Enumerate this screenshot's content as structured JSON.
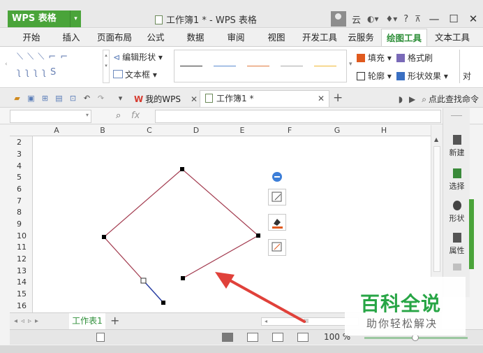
{
  "app": {
    "name": "WPS 表格",
    "title": "工作簿1 * - WPS 表格"
  },
  "titlebar": {
    "cloud_label": "云",
    "help_label": "?",
    "minimize": "—",
    "maximize": "☐",
    "close": "✕"
  },
  "menu_tabs": [
    "开始",
    "插入",
    "页面布局",
    "公式",
    "数据",
    "审阅",
    "视图",
    "开发工具",
    "云服务",
    "绘图工具",
    "文本工具"
  ],
  "active_tab": "绘图工具",
  "ribbon": {
    "edit_shape": "编辑形状",
    "textbox": "文本框",
    "fill": "填充",
    "format_painter": "格式刷",
    "outline": "轮廓",
    "shape_effects": "形状效果",
    "align_fragment": "对"
  },
  "quickbar": {
    "my_wps": "我的WPS",
    "doc_tab": "工作簿1 *",
    "search": "点此查找命令"
  },
  "formula": {
    "fx": "fx"
  },
  "columns": [
    "A",
    "B",
    "C",
    "D",
    "E",
    "F",
    "G",
    "H"
  ],
  "rows": [
    "2",
    "3",
    "4",
    "5",
    "6",
    "7",
    "8",
    "9",
    "10",
    "11",
    "12",
    "13",
    "14",
    "15",
    "16"
  ],
  "side_panel": [
    "新建",
    "选择",
    "形状",
    "属性"
  ],
  "sheet_tab": "工作表1",
  "hscroll_label": "III",
  "zoom": "100 %",
  "watermark": {
    "title": "百科全说",
    "subtitle": "助你轻松解决"
  },
  "colors": {
    "accent": "#4aa43a",
    "shape_line": "#a23a4e",
    "handle_line": "#2a3fa3",
    "arrow": "#e0413a"
  }
}
